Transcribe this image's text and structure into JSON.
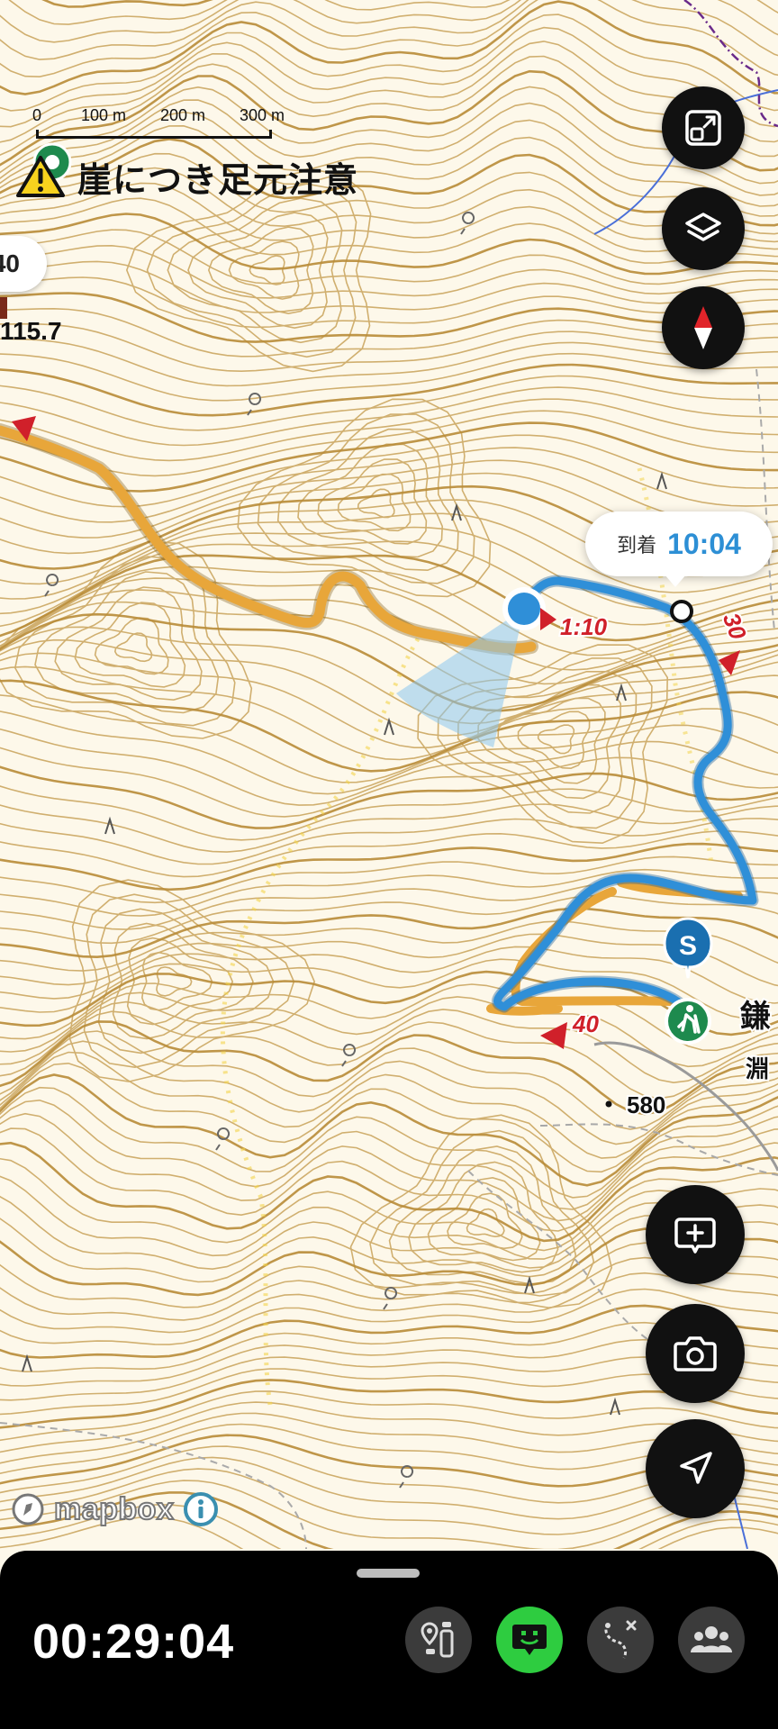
{
  "scale_bar": {
    "labels": [
      "0",
      "100 m",
      "200 m",
      "300 m"
    ]
  },
  "warning": {
    "text": "崖につき足元注意",
    "icon": "warning-triangle-icon"
  },
  "left_chip": {
    "text": "40"
  },
  "left_elevation": {
    "text": "115.7"
  },
  "route_markers": {
    "time_left": "1:10",
    "time_right": "30",
    "time_bottom": "40"
  },
  "start_marker": {
    "letter": "S"
  },
  "place_labels": {
    "kama_top": "鎌",
    "kama_bottom": "淵",
    "elevation_580": "580"
  },
  "eta": {
    "label": "到着",
    "time": "10:04"
  },
  "map_buttons": [
    {
      "icon": "expand-icon"
    },
    {
      "icon": "layers-icon"
    },
    {
      "icon": "compass-icon"
    },
    {
      "icon": "add-comment-icon"
    },
    {
      "icon": "camera-icon"
    },
    {
      "icon": "navigate-arrow-icon"
    }
  ],
  "attribution": {
    "logo": "mapbox",
    "info_icon": "info-icon"
  },
  "bottom_bar": {
    "timer": "00:29:04",
    "tools": [
      {
        "icon": "waypoint-icon",
        "active": false
      },
      {
        "icon": "chat-smile-icon",
        "active": true
      },
      {
        "icon": "route-icon",
        "active": false
      },
      {
        "icon": "group-icon",
        "active": false
      }
    ]
  },
  "colors": {
    "route_blue": "#2f8fd8",
    "planned_orange": "#e8a63a",
    "contour": "#c9a35a",
    "direction_red": "#d0202a",
    "start_blue": "#1a6fb0",
    "trailhead_green": "#1e8a4e",
    "active_green": "#2ecc40"
  }
}
